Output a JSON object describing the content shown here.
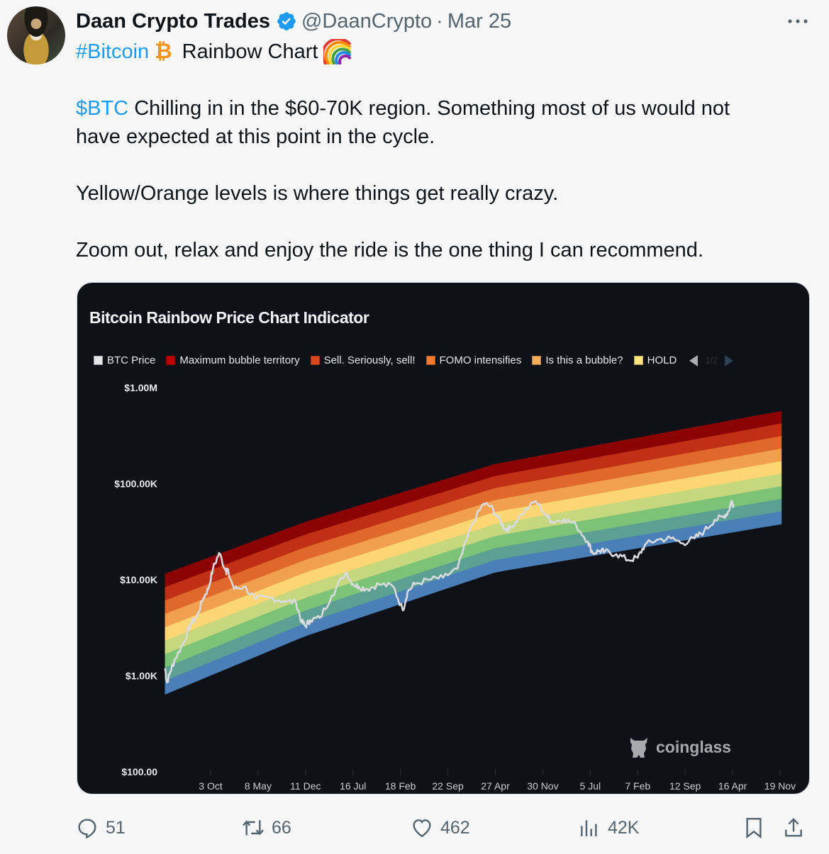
{
  "tweet": {
    "author_name": "Daan Crypto Trades",
    "handle": "@DaanCrypto",
    "separator": "·",
    "date": "Mar 25",
    "hashtag": "#Bitcoin",
    "btc_emoji": "₿",
    "title_text": "Rainbow Chart",
    "cashtag": "$BTC",
    "line1_rest": " Chilling in in the $60-70K region. Something most of us would not",
    "line2": "have expected at this point in the cycle.",
    "line3": "Yellow/Orange levels is where things get really crazy.",
    "line4": "Zoom out, relax and enjoy the ride is the one thing I can recommend.",
    "icons": {
      "verified": "verified-badge-icon",
      "more": "more-icon",
      "rainbow": "rainbow-emoji-icon"
    }
  },
  "media": {
    "watermark": "coinglass",
    "legend_page": "1/2"
  },
  "actions": {
    "replies": "51",
    "reposts": "66",
    "likes": "462",
    "views": "42K"
  },
  "colors": {
    "link": "#1d9bf0",
    "muted": "#536471",
    "chart_bg": "#0e1118",
    "price_line": "#d9dbe0"
  },
  "chart_data": {
    "type": "area",
    "title": "Bitcoin Rainbow Price Chart Indicator",
    "yscale": "log",
    "ylim": [
      100,
      1000000
    ],
    "y_ticks": [
      "$1.00M",
      "$100.00K",
      "$10.00K",
      "$1.00K",
      "$100.00"
    ],
    "y_tick_values": [
      1000000,
      100000,
      10000,
      1000,
      100
    ],
    "x_ticks": [
      "3 Oct",
      "8 May",
      "11 Dec",
      "16 Jul",
      "18 Feb",
      "22 Sep",
      "27 Apr",
      "30 Nov",
      "5 Jul",
      "7 Feb",
      "12 Sep",
      "16 Apr",
      "19 Nov"
    ],
    "x_note": "x values are positions measured in tick-intervals, 0 = '3 Oct', 12 = '19 Nov'",
    "xlim": [
      -0.96,
      12.03
    ],
    "legend_position": "top",
    "legend": [
      {
        "name": "BTC Price",
        "color": "#e4e6ea"
      },
      {
        "name": "Maximum bubble territory",
        "color": "#c00000"
      },
      {
        "name": "Sell. Seriously, sell!",
        "color": "#d9481c"
      },
      {
        "name": "FOMO intensifies",
        "color": "#f07b2e"
      },
      {
        "name": "Is this a bubble?",
        "color": "#f6ae56"
      },
      {
        "name": "HOLD",
        "color": "#fbe57c"
      }
    ],
    "bands": [
      {
        "color": "#8b0304"
      },
      {
        "color": "#c03014"
      },
      {
        "color": "#e0682a"
      },
      {
        "color": "#f0a04e"
      },
      {
        "color": "#fbd673"
      },
      {
        "color": "#c6d77e"
      },
      {
        "color": "#7dc377"
      },
      {
        "color": "#5ba092"
      },
      {
        "color": "#4a7fb7"
      }
    ],
    "band_top": {
      "x": [
        -0.96,
        2.0,
        6.0,
        12.03
      ],
      "y": [
        11500,
        40000,
        160000,
        570000
      ]
    },
    "band_bottom": {
      "x": [
        -0.96,
        2.0,
        6.0,
        12.03
      ],
      "y": [
        640,
        2600,
        12000,
        38000
      ]
    },
    "series": [
      {
        "name": "BTC Price",
        "x": [
          -0.96,
          -0.92,
          -0.85,
          -0.75,
          -0.55,
          -0.42,
          -0.3,
          -0.15,
          -0.05,
          0.05,
          0.18,
          0.33,
          0.34,
          0.5,
          0.7,
          0.95,
          1.25,
          1.55,
          1.8,
          1.92,
          2.0,
          2.1,
          2.3,
          2.55,
          2.85,
          3.0,
          3.12,
          3.3,
          3.55,
          3.85,
          4.05,
          4.15,
          4.3,
          4.6,
          4.9,
          5.2,
          5.5,
          5.75,
          5.9,
          6.05,
          6.2,
          6.3,
          6.55,
          6.85,
          7.1,
          7.2,
          7.45,
          7.7,
          7.95,
          8.05,
          8.2,
          8.3,
          8.55,
          8.8,
          9.0,
          9.15,
          9.4,
          9.7,
          9.95,
          10.2,
          10.4,
          10.62,
          10.8,
          10.92,
          10.97,
          11.02
        ],
        "y": [
          1200,
          850,
          1100,
          1500,
          2300,
          3500,
          4000,
          6500,
          8000,
          13000,
          19000,
          12000,
          13000,
          8000,
          8500,
          6300,
          6500,
          6000,
          5800,
          3600,
          3300,
          3800,
          4000,
          6800,
          12000,
          9000,
          8500,
          8000,
          9000,
          8500,
          4800,
          7500,
          9000,
          10000,
          10500,
          13000,
          37000,
          62000,
          58000,
          45000,
          34000,
          34000,
          48000,
          66000,
          45000,
          40000,
          43000,
          37000,
          25000,
          19000,
          20000,
          19500,
          18500,
          16000,
          17000,
          23000,
          26000,
          27000,
          24000,
          27000,
          32000,
          42000,
          45000,
          52000,
          66000,
          61000
        ]
      }
    ]
  }
}
